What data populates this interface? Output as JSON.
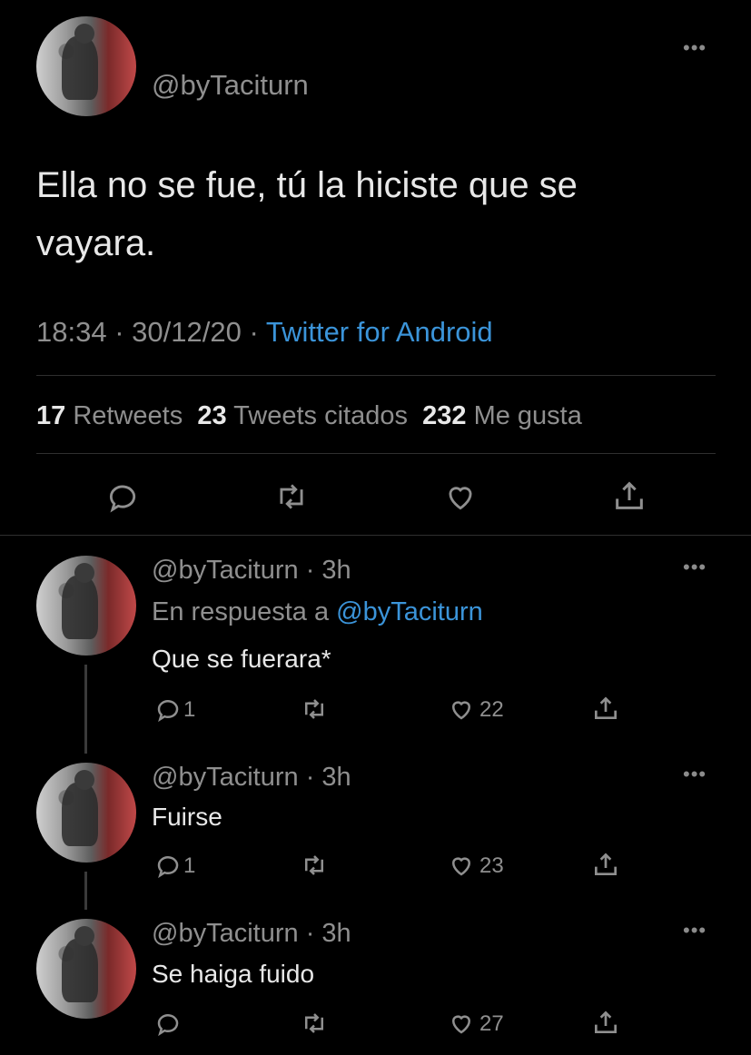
{
  "main_tweet": {
    "handle": "@byTaciturn",
    "text_line1": "Ella no se fue, tú la hiciste que se",
    "text_line2": "vayara.",
    "time": "18:34",
    "date": "30/12/20",
    "separator": "·",
    "source": "Twitter for Android",
    "stats": {
      "retweets_count": "17",
      "retweets_label": "Retweets",
      "quotes_count": "23",
      "quotes_label": "Tweets citados",
      "likes_count": "232",
      "likes_label": "Me gusta"
    },
    "more": "•••"
  },
  "replies": [
    {
      "handle": "@byTaciturn",
      "time": "· 3h",
      "reply_prefix": "En respuesta a",
      "reply_to": "@byTaciturn",
      "text": "Que se fuerara*",
      "reply_count": "1",
      "like_count": "22",
      "more": "•••"
    },
    {
      "handle": "@byTaciturn",
      "time": "· 3h",
      "text": "Fuirse",
      "reply_count": "1",
      "like_count": "23",
      "more": "•••"
    },
    {
      "handle": "@byTaciturn",
      "time": "· 3h",
      "text": "Se haiga fuido",
      "like_count": "27",
      "more": "•••"
    }
  ],
  "icons": [
    "reply-icon",
    "retweet-icon",
    "like-icon",
    "share-icon",
    "more-icon"
  ]
}
